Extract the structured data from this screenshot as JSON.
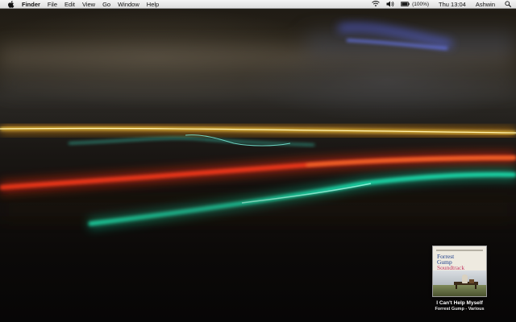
{
  "menubar": {
    "apple_icon": "apple-icon",
    "app_name": "Finder",
    "items": [
      "File",
      "Edit",
      "View",
      "Go",
      "Window",
      "Help"
    ],
    "status": {
      "wifi_icon": "wifi-icon",
      "volume_icon": "volume-icon",
      "battery_icon": "battery-icon",
      "battery_text": "(100%)",
      "clock": "Thu 13:04",
      "user": "Ashwin",
      "spotlight_icon": "spotlight-search-icon"
    }
  },
  "now_playing": {
    "album_art_text": {
      "line1": "Forrest",
      "line2": "Gump",
      "line3": "Soundtrack"
    },
    "track": "I Can't Help Myself",
    "album_artist": "Forrest Gump - Various"
  },
  "colors": {
    "menubar_top": "#f4f4f4",
    "menubar_bottom": "#dedede",
    "light_yellow": "#ffd23a",
    "light_red": "#ff3a1a",
    "light_teal": "#1ee6b4",
    "light_blue": "#5a6cff"
  }
}
